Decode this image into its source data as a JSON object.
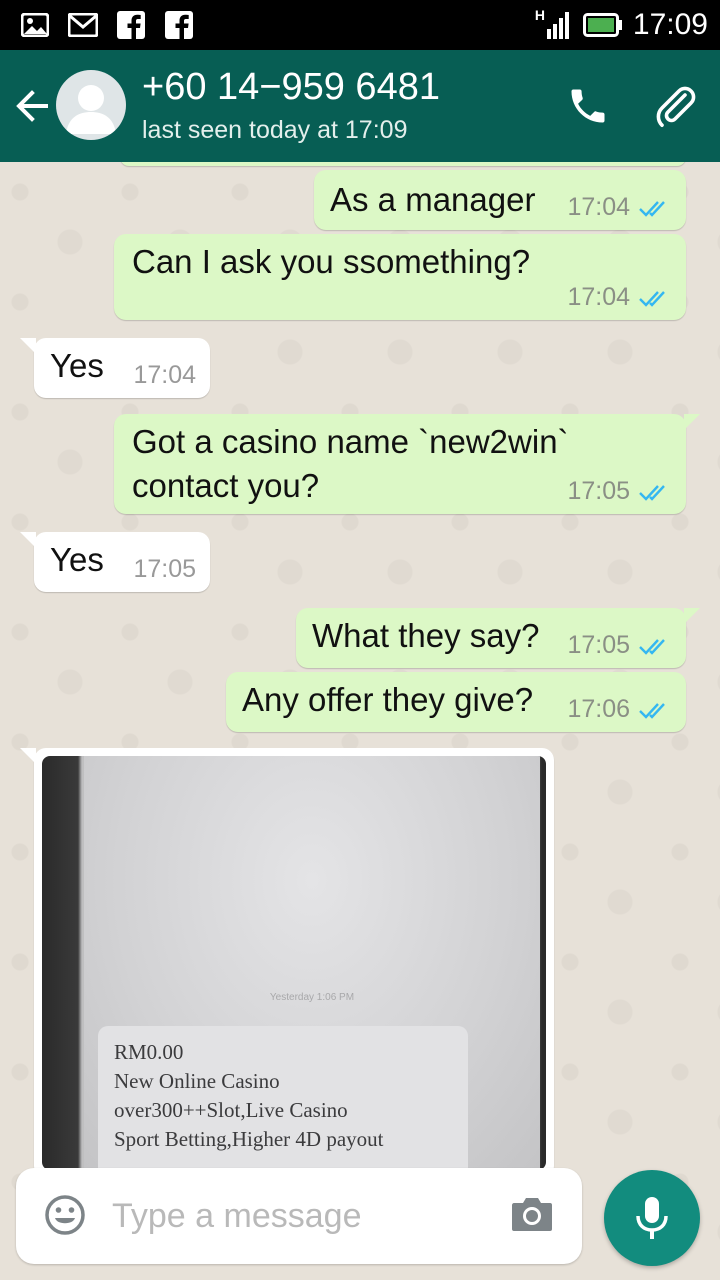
{
  "status_bar": {
    "time": "17:09",
    "network_label": "H",
    "left_icons": [
      "gallery-icon",
      "gmail-icon",
      "facebook-icon",
      "facebook-icon"
    ],
    "right_icons": [
      "signal-icon",
      "battery-icon"
    ]
  },
  "header": {
    "contact": "+60 14−959 6481",
    "last_seen": "last seen today at 17:09",
    "icons": [
      "back-arrow-icon",
      "avatar-icon",
      "phone-icon",
      "paperclip-icon"
    ]
  },
  "messages": [
    {
      "direction": "out",
      "text": "As a manager",
      "time": "17:04",
      "status": "read"
    },
    {
      "direction": "out",
      "text": "Can I ask you ssomething?",
      "time": "17:04",
      "status": "read"
    },
    {
      "direction": "in",
      "text": "Yes",
      "time": "17:04"
    },
    {
      "direction": "out",
      "text": "Got a casino name `new2win` contact you?",
      "text_line1": "Got a casino name `new2win`",
      "text_line2": "contact you?",
      "time": "17:05",
      "status": "read"
    },
    {
      "direction": "in",
      "text": "Yes",
      "time": "17:05"
    },
    {
      "direction": "out",
      "text": "What they say?",
      "time": "17:05",
      "status": "read"
    },
    {
      "direction": "out",
      "text": "Any offer they give?",
      "time": "17:06",
      "status": "read"
    }
  ],
  "photo_message": {
    "direction": "in",
    "stamp": "Yesterday 1:06 PM",
    "lines": [
      "RM0.00",
      "New Online Casino",
      "over300++Slot,Live Casino",
      "Sport Betting,Higher 4D payout"
    ]
  },
  "composer": {
    "placeholder": "Type a message",
    "icons": [
      "emoji-icon",
      "camera-icon",
      "microphone-icon"
    ]
  },
  "colors": {
    "header": "#075e54",
    "outgoing_bubble": "#dcf8c6",
    "incoming_bubble": "#ffffff",
    "read_ticks": "#34b7f1",
    "mic_button": "#128c7e"
  }
}
